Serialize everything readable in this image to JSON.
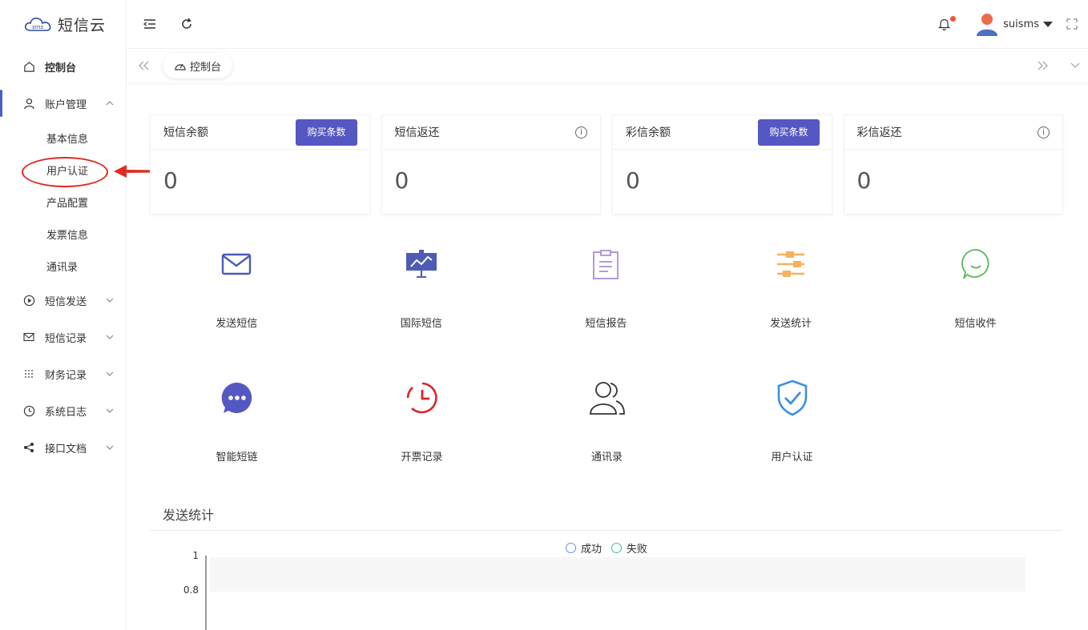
{
  "app": {
    "logo_text": "短信云",
    "logo_mark": "sms"
  },
  "sidebar": {
    "items": [
      {
        "label": "控制台",
        "icon": "home-icon"
      },
      {
        "label": "账户管理",
        "icon": "user-icon",
        "expanded": true,
        "children": [
          "基本信息",
          "用户认证",
          "产品配置",
          "发票信息",
          "通讯录"
        ]
      },
      {
        "label": "短信发送",
        "icon": "play-circle-icon"
      },
      {
        "label": "短信记录",
        "icon": "mail-icon"
      },
      {
        "label": "财务记录",
        "icon": "grid-icon"
      },
      {
        "label": "系统日志",
        "icon": "clock-icon"
      },
      {
        "label": "接口文档",
        "icon": "share-icon"
      }
    ]
  },
  "header": {
    "user_name": "suisms",
    "has_notification": true
  },
  "tabs": [
    {
      "label": "控制台",
      "icon": "dashboard-icon"
    }
  ],
  "cards": [
    {
      "title": "短信余额",
      "value": "0",
      "action": "购买条数"
    },
    {
      "title": "短信返还",
      "value": "0",
      "info": "i"
    },
    {
      "title": "彩信余额",
      "value": "0",
      "action": "购买条数"
    },
    {
      "title": "彩信返还",
      "value": "0",
      "info": "i"
    }
  ],
  "shortcuts": [
    {
      "label": "发送短信",
      "icon": "envelope-icon",
      "color": "#4e5bb5"
    },
    {
      "label": "国际短信",
      "icon": "presentation-icon",
      "color": "#4e5bb5"
    },
    {
      "label": "短信报告",
      "icon": "clipboard-icon",
      "color": "#a98ed6"
    },
    {
      "label": "发送统计",
      "icon": "sliders-icon",
      "color": "#f5b25b"
    },
    {
      "label": "短信收件",
      "icon": "chat-smile-icon",
      "color": "#5cb85c"
    },
    {
      "label": "智能短链",
      "icon": "chat-dots-icon",
      "color": "#5557c3"
    },
    {
      "label": "开票记录",
      "icon": "clock-alarm-icon",
      "color": "#d9252a"
    },
    {
      "label": "通讯录",
      "icon": "contacts-icon",
      "color": "#333333"
    },
    {
      "label": "用户认证",
      "icon": "shield-check-icon",
      "color": "#3a8ee6"
    }
  ],
  "stats": {
    "title": "发送统计",
    "legend": [
      "成功",
      "失败"
    ]
  },
  "chart_data": {
    "type": "line",
    "series": [
      {
        "name": "成功",
        "values": []
      },
      {
        "name": "失败",
        "values": []
      }
    ],
    "ytick_labels": [
      "1",
      "0.8"
    ],
    "ylim": [
      0,
      1
    ]
  }
}
